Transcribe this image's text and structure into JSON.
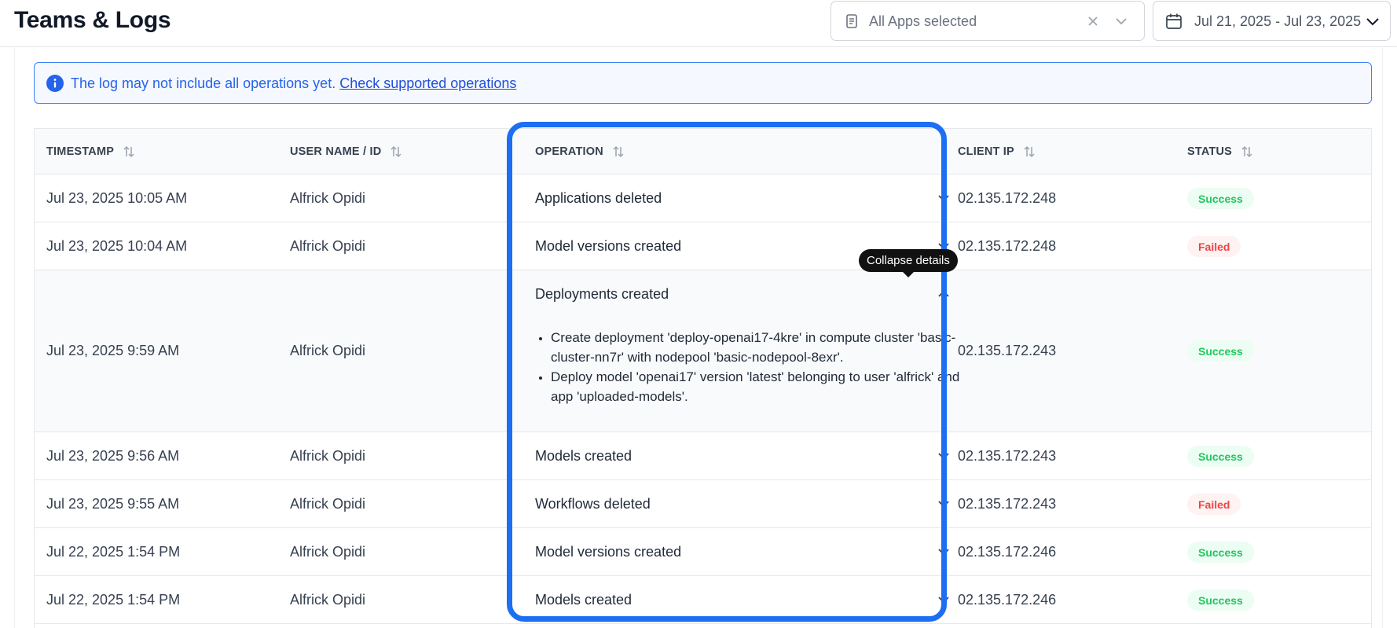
{
  "header": {
    "title": "Teams & Logs",
    "app_filter": {
      "value": "All Apps selected"
    },
    "date_filter": {
      "value": "Jul 21, 2025 - Jul 23, 2025"
    }
  },
  "banner": {
    "text": "The log may not include all operations yet.",
    "link": "Check supported operations"
  },
  "table": {
    "columns": {
      "timestamp": "TIMESTAMP",
      "user": "USER NAME / ID",
      "operation": "OPERATION",
      "client_ip": "CLIENT IP",
      "status": "STATUS"
    },
    "rows": [
      {
        "timestamp": "Jul 23, 2025 10:05 AM",
        "user": "Alfrick Opidi",
        "operation": "Applications deleted",
        "client_ip": "02.135.172.248",
        "status": "Success"
      },
      {
        "timestamp": "Jul 23, 2025 10:04 AM",
        "user": "Alfrick Opidi",
        "operation": "Model versions created",
        "client_ip": "02.135.172.248",
        "status": "Failed"
      },
      {
        "timestamp": "Jul 23, 2025 9:59 AM",
        "user": "Alfrick Opidi",
        "operation": "Deployments created",
        "client_ip": "02.135.172.243",
        "status": "Success",
        "details": [
          "Create deployment 'deploy-openai17-4kre' in compute cluster 'basic-cluster-nn7r' with nodepool 'basic-nodepool-8exr'.",
          "Deploy model 'openai17' version 'latest' belonging to user 'alfrick' and app 'uploaded-models'."
        ]
      },
      {
        "timestamp": "Jul 23, 2025 9:56 AM",
        "user": "Alfrick Opidi",
        "operation": "Models created",
        "client_ip": "02.135.172.243",
        "status": "Success"
      },
      {
        "timestamp": "Jul 23, 2025 9:55 AM",
        "user": "Alfrick Opidi",
        "operation": "Workflows deleted",
        "client_ip": "02.135.172.243",
        "status": "Failed"
      },
      {
        "timestamp": "Jul 22, 2025 1:54 PM",
        "user": "Alfrick Opidi",
        "operation": "Model versions created",
        "client_ip": "02.135.172.246",
        "status": "Success"
      },
      {
        "timestamp": "Jul 22, 2025 1:54 PM",
        "user": "Alfrick Opidi",
        "operation": "Models created",
        "client_ip": "02.135.172.246",
        "status": "Success"
      }
    ]
  },
  "tooltip": {
    "text": "Collapse details"
  },
  "colors": {
    "accent": "#1c6ef2",
    "success": "#22c55e",
    "failed": "#ef4444",
    "info": "#2563eb"
  },
  "icons": {
    "app_filter": "document-icon",
    "clear": "close-icon",
    "dropdown": "chevron-down-icon",
    "date": "calendar-icon",
    "info": "info-icon",
    "sort": "sort-icon",
    "expand": "chevron-down-icon",
    "collapse": "chevron-up-icon"
  }
}
